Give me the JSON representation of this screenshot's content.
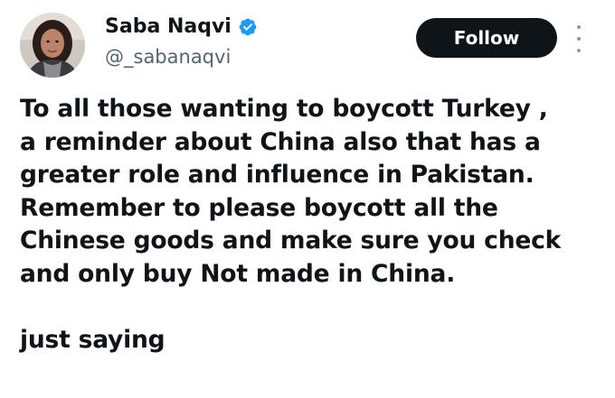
{
  "author": {
    "display_name": "Saba Naqvi",
    "handle": "@_sabanaqvi",
    "verified": true,
    "avatar_icon": "profile-photo"
  },
  "actions": {
    "follow_label": "Follow",
    "more_icon": "more-vertical-icon"
  },
  "tweet": {
    "lines": [
      "To all those wanting to boycott Turkey ,",
      "a reminder about China also that has a",
      "greater role and influence in Pakistan.",
      "Remember to please boycott all the",
      "Chinese goods and make sure you check",
      "and only buy Not made in China."
    ],
    "closing": "just saying"
  },
  "colors": {
    "text": "#0f1419",
    "secondary_text": "#536471",
    "follow_bg": "#0f1419",
    "verified_blue": "#1d9bf0"
  }
}
